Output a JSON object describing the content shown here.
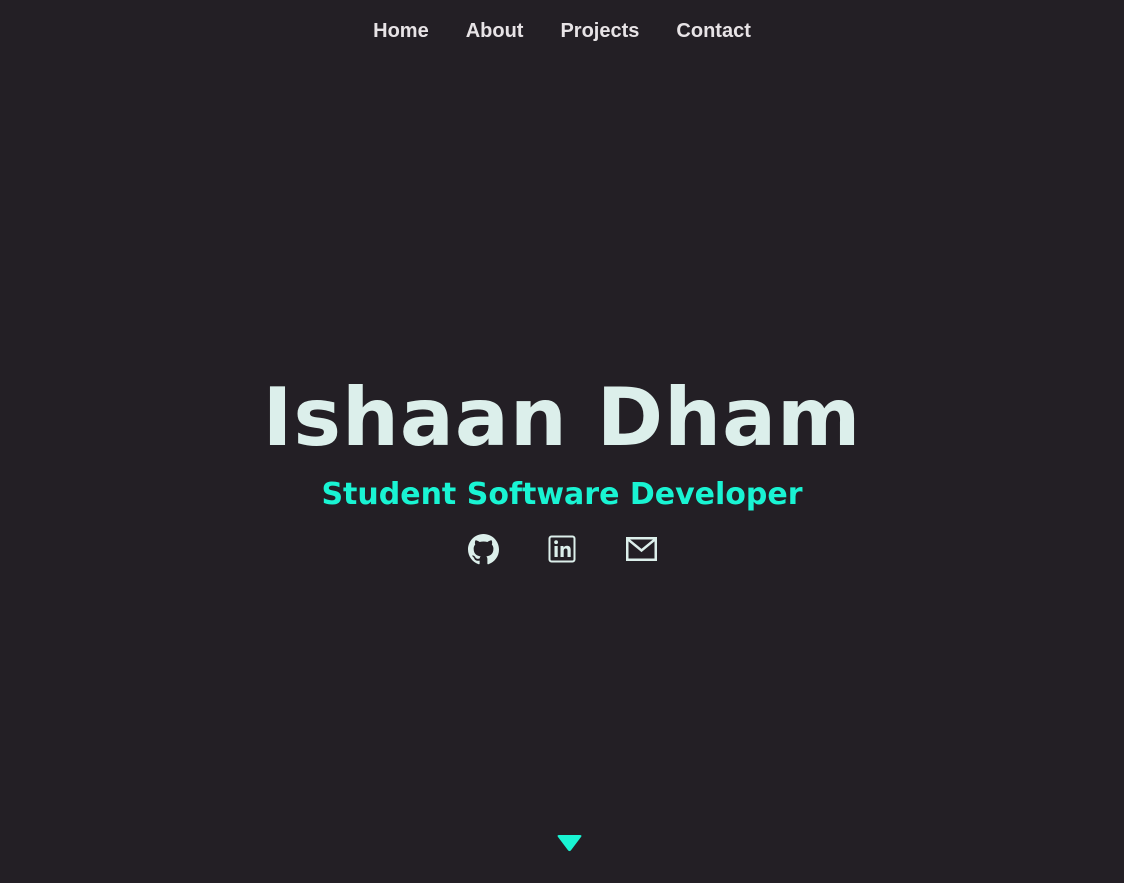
{
  "nav": {
    "items": [
      {
        "label": "Home"
      },
      {
        "label": "About"
      },
      {
        "label": "Projects"
      },
      {
        "label": "Contact"
      }
    ]
  },
  "hero": {
    "name": "Ishaan Dham",
    "tagline": "Student Software Developer"
  },
  "socials": [
    {
      "icon": "github-icon"
    },
    {
      "icon": "linkedin-icon"
    },
    {
      "icon": "email-icon"
    }
  ],
  "scroll_indicator": {
    "icon": "chevron-down-icon"
  },
  "colors": {
    "background": "#231f25",
    "nav_text": "#e7e3e6",
    "name_text": "#dcefeb",
    "accent": "#19f4d3"
  }
}
